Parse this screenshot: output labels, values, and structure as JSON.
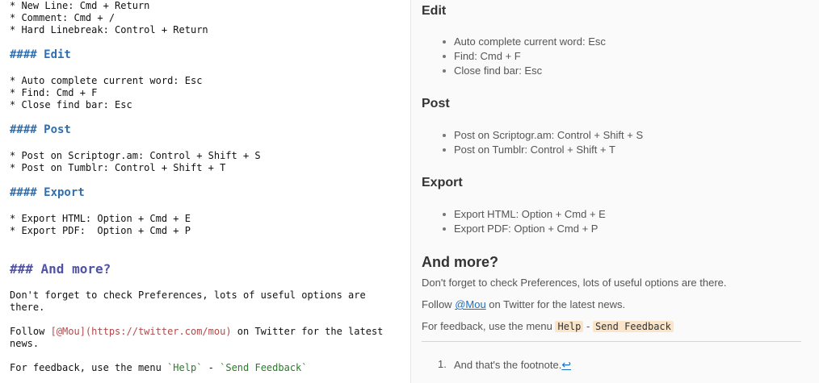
{
  "editor": {
    "shortcut_lines": [
      "* New Line: Cmd + Return",
      "* Comment: Cmd + /",
      "* Hard Linebreak: Control + Return"
    ],
    "h_edit": "#### Edit",
    "edit_lines": [
      "* Auto complete current word: Esc",
      "* Find: Cmd + F",
      "* Close find bar: Esc"
    ],
    "h_post": "#### Post",
    "post_lines": [
      "* Post on Scriptogr.am: Control + Shift + S",
      "* Post on Tumblr: Control + Shift + T"
    ],
    "h_export": "#### Export",
    "export_lines": [
      "* Export HTML: Option + Cmd + E",
      "* Export PDF:  Option + Cmd + P"
    ],
    "h_more": "### And more?",
    "prefs_line1": "Don't forget to check Preferences, lots of useful options are",
    "prefs_line2": "there.",
    "follow_prefix": "Follow ",
    "follow_link": "[@Mou](https://twitter.com/mou)",
    "follow_suffix": " on Twitter for the latest",
    "follow_line2": "news.",
    "feedback_prefix": "For feedback, use the menu ",
    "feedback_help": "`Help`",
    "feedback_sep": " - ",
    "feedback_send": "`Send Feedback`"
  },
  "preview": {
    "h_edit": "Edit",
    "edit_items": [
      "Auto complete current word: Esc",
      "Find: Cmd + F",
      "Close find bar: Esc"
    ],
    "h_post": "Post",
    "post_items": [
      "Post on Scriptogr.am: Control + Shift + S",
      "Post on Tumblr: Control + Shift + T"
    ],
    "h_export": "Export",
    "export_items": [
      "Export HTML: Option + Cmd + E",
      "Export PDF: Option + Cmd + P"
    ],
    "h_more": "And more?",
    "prefs": "Don't forget to check Preferences, lots of useful options are there.",
    "follow_prefix": "Follow ",
    "follow_link": "@Mou",
    "follow_suffix": " on Twitter for the latest news.",
    "feedback_prefix": "For feedback, use the menu ",
    "feedback_help": "Help",
    "feedback_sep": " - ",
    "feedback_send": "Send Feedback",
    "footnote_number": "1.",
    "footnote_text": "And that's the footnote.",
    "footnote_backref": "↩"
  }
}
